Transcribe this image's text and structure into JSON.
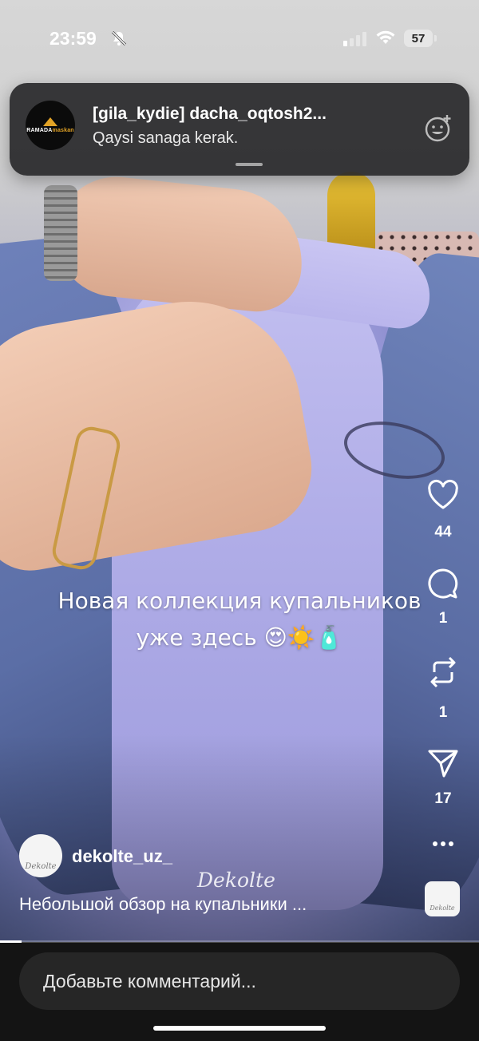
{
  "status_bar": {
    "time": "23:59",
    "battery": "57"
  },
  "notification": {
    "avatar_brand_left": "RAMADA",
    "avatar_brand_right": "maskan",
    "title": "[gila_kydie] dacha_oqtosh2...",
    "message": "Qaysi sanaga kerak."
  },
  "video": {
    "overlay_line1": "Новая коллекция купальников",
    "overlay_line2": "уже здесь 😍☀️🧴",
    "watermark": "Dekolte"
  },
  "actions": {
    "likes": "44",
    "comments": "1",
    "reposts": "1",
    "shares": "17"
  },
  "author": {
    "avatar_text": "Dekolte",
    "username": "dekolte_uz_",
    "caption": "Небольшой обзор на купальники ..."
  },
  "audio": {
    "thumb_text": "Dekolte"
  },
  "playback": {
    "progress_fraction": 0.045
  },
  "comment_bar": {
    "placeholder": "Добавьте комментарий..."
  },
  "icons": {
    "like": "heart-icon",
    "comment": "comment-bubble-icon",
    "repost": "repost-icon",
    "share": "send-icon",
    "more": "more-dots-icon",
    "mute": "bell-slash-icon",
    "react": "add-reaction-icon"
  }
}
